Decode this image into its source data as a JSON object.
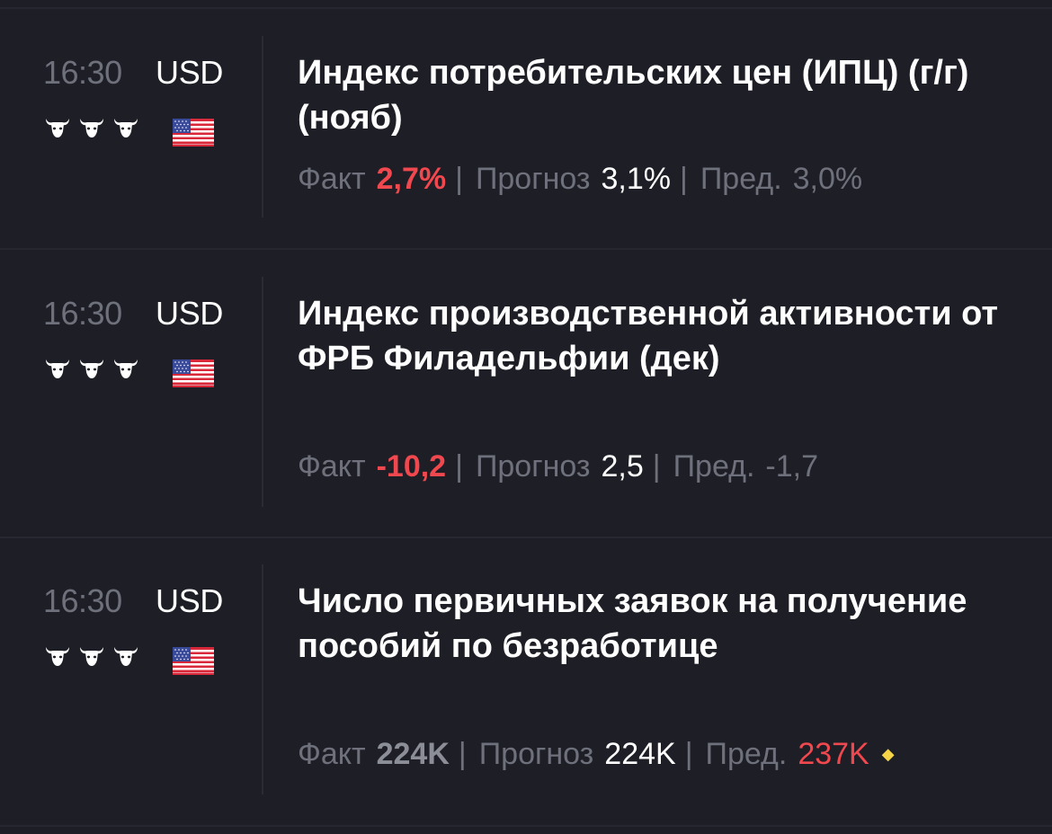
{
  "events": [
    {
      "time": "16:30",
      "currency": "USD",
      "title": "Индекс потребительских цен (ИПЦ) (г/г) (нояб)",
      "importance": 3,
      "flag": "us-flag-icon",
      "actual_label": "Факт",
      "actual": "2,7%",
      "forecast_label": "Прогноз",
      "forecast": "3,1%",
      "previous_label": "Пред.",
      "previous": "3,0%"
    },
    {
      "time": "16:30",
      "currency": "USD",
      "title": "Индекс производственной активности от ФРБ Филадельфии (дек)",
      "importance": 3,
      "flag": "us-flag-icon",
      "actual_label": "Факт",
      "actual": "-10,2",
      "forecast_label": "Прогноз",
      "forecast": "2,5",
      "previous_label": "Пред.",
      "previous": "-1,7"
    },
    {
      "time": "16:30",
      "currency": "USD",
      "title": "Число первичных заявок на получение пособий по безработице",
      "importance": 3,
      "flag": "us-flag-icon",
      "actual_label": "Факт",
      "actual": "224K",
      "forecast_label": "Прогноз",
      "forecast": "224K",
      "previous_label": "Пред.",
      "previous": "237K",
      "previous_revised_marker": "diamond-icon"
    }
  ],
  "colors": {
    "background": "#1e1f26",
    "negative": "#f0484e",
    "muted": "#6e707b",
    "revision_marker": "#f5d547"
  }
}
